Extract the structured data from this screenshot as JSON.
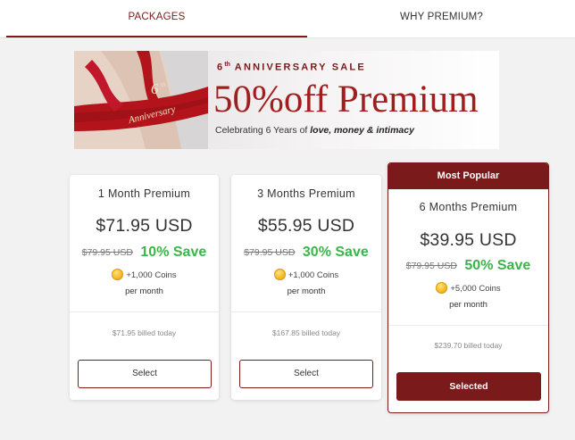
{
  "tabs": [
    {
      "label": "PACKAGES",
      "active": true
    },
    {
      "label": "WHY PREMIUM?",
      "active": false
    }
  ],
  "banner": {
    "ordinal_number": "6",
    "ordinal_suffix": "th",
    "title": "ANNIVERSARY SALE",
    "headline": "50%off Premium",
    "celebrate_prefix": "Celebrating 6 Years of ",
    "celebrate_bold": "love, money & intimacy",
    "ribbon_number": "6",
    "ribbon_suffix": "th",
    "ribbon_text": "Anniversary"
  },
  "packages": [
    {
      "title": "1 Month Premium",
      "price": "$71.95 USD",
      "original_price": "$79.95 USD",
      "save": "10% Save",
      "coins": "+1,000 Coins",
      "per_month": "per month",
      "billed": "$71.95 billed today",
      "button": "Select",
      "selected": false
    },
    {
      "title": "3 Months Premium",
      "price": "$55.95 USD",
      "original_price": "$79.95 USD",
      "save": "30% Save",
      "coins": "+1,000 Coins",
      "per_month": "per month",
      "billed": "$167.85 billed today",
      "button": "Select",
      "selected": false
    },
    {
      "badge": "Most Popular",
      "title": "6 Months Premium",
      "price": "$39.95 USD",
      "original_price": "$79.95 USD",
      "save": "50% Save",
      "coins": "+5,000 Coins",
      "per_month": "per month",
      "billed": "$239.70 billed today",
      "button": "Selected",
      "selected": true
    }
  ],
  "colors": {
    "brand": "#7a1a1a",
    "save_green": "#3bb54a",
    "headline_red": "#a01e1e",
    "coin_gold": "#f0b51e"
  }
}
